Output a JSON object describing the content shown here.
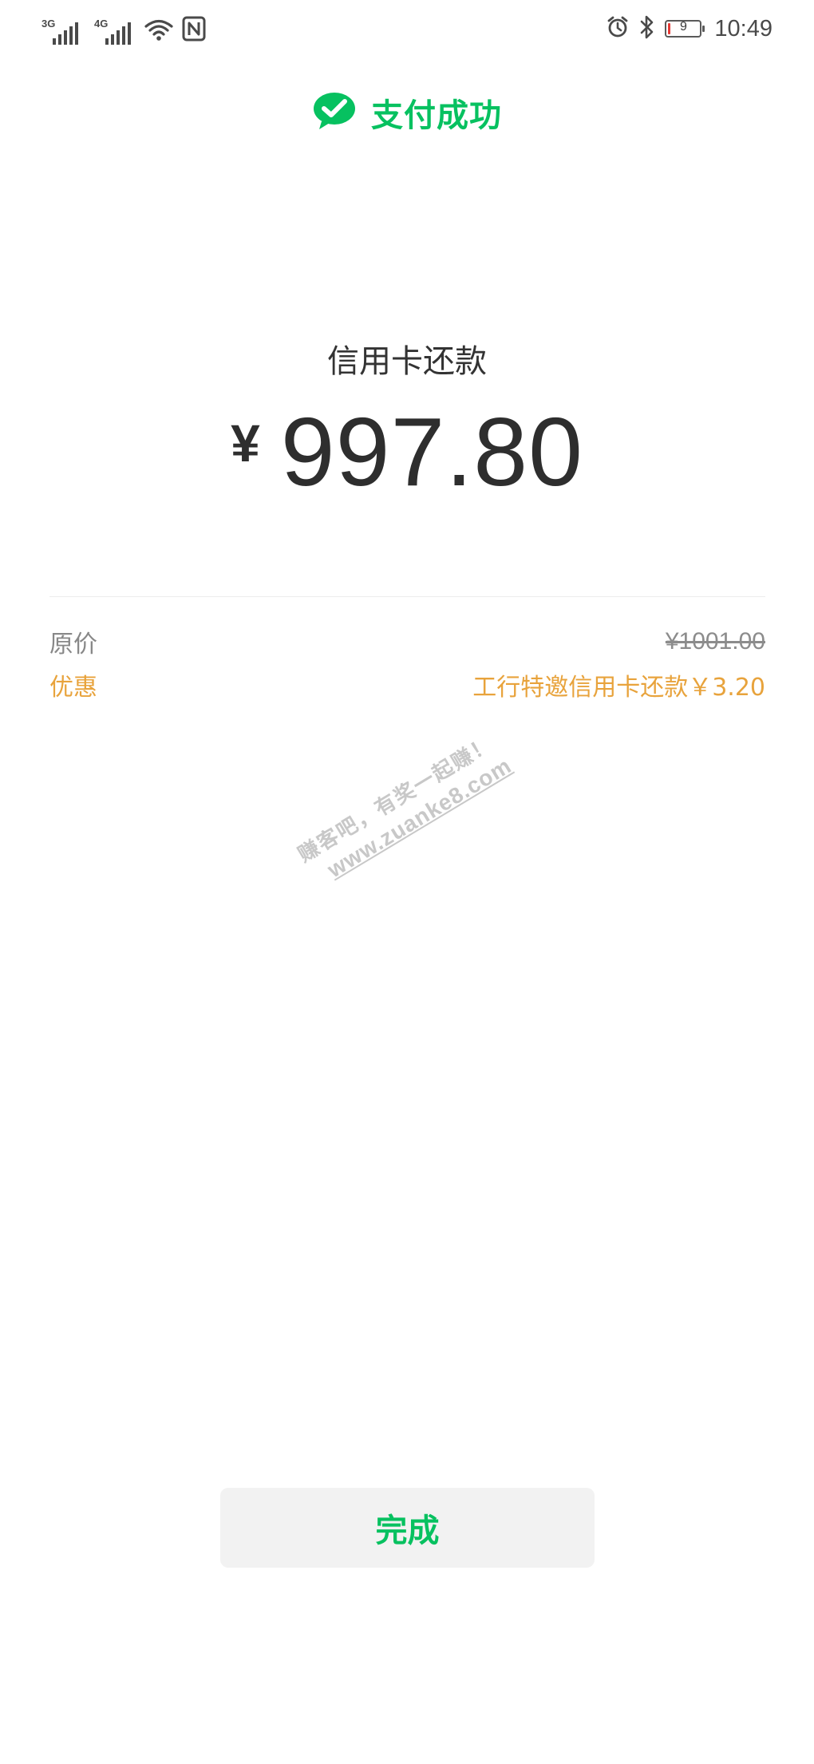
{
  "status_bar": {
    "sim1_network": "3G",
    "sim2_network": "4G",
    "battery_level": "9",
    "battery_fraction": 0.09,
    "time": "10:49",
    "icons": [
      "signal-icon",
      "wifi-icon",
      "nfc-icon",
      "alarm-icon",
      "bluetooth-icon",
      "battery-icon"
    ]
  },
  "header": {
    "title": "支付成功",
    "icon": "wechat-pay-icon"
  },
  "payment": {
    "merchant": "信用卡还款",
    "currency_symbol": "¥",
    "amount": "997.80"
  },
  "details": {
    "original_label": "原价",
    "original_value": "¥1001.00",
    "discount_label": "优惠",
    "discount_value": "工行特邀信用卡还款￥3.20"
  },
  "watermark": {
    "line1": "赚客吧，有奖一起赚！",
    "line2": "www.zuanke8.com"
  },
  "actions": {
    "done_label": "完成"
  },
  "colors": {
    "brand_green": "#07c160",
    "discount_orange": "#e8a33c",
    "muted_gray": "#888888",
    "button_bg": "#f2f2f2",
    "battery_low": "#e53935"
  }
}
